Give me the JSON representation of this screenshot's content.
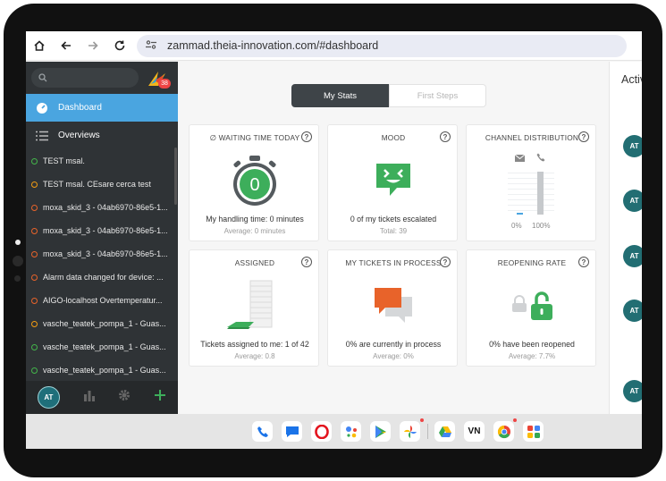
{
  "browser": {
    "url": "zammad.theia-innovation.com/#dashboard"
  },
  "sidebar": {
    "logo_badge": "38",
    "nav": [
      {
        "label": "Dashboard",
        "icon": "dashboard-icon"
      },
      {
        "label": "Overviews",
        "icon": "list-icon"
      }
    ],
    "tickets": [
      {
        "title": "TEST msal.",
        "status_color": "#43b54b"
      },
      {
        "title": "TEST msal. CEsare cerca test",
        "status_color": "#f39c12"
      },
      {
        "title": "moxa_skid_3 - 04ab6970-86e5-1...",
        "status_color": "#e8632a"
      },
      {
        "title": "moxa_skid_3 - 04ab6970-86e5-1...",
        "status_color": "#e8632a"
      },
      {
        "title": "moxa_skid_3 - 04ab6970-86e5-1...",
        "status_color": "#e8632a"
      },
      {
        "title": "Alarm data changed for device: ...",
        "status_color": "#e8632a"
      },
      {
        "title": "AIGO-localhost Overtemperatur...",
        "status_color": "#e8632a"
      },
      {
        "title": "vasche_teatek_pompa_1 - Guas...",
        "status_color": "#f39c12"
      },
      {
        "title": "vasche_teatek_pompa_1 - Guas...",
        "status_color": "#43b54b"
      },
      {
        "title": "vasche_teatek_pompa_1 - Guas...",
        "status_color": "#43b54b"
      }
    ],
    "footer": {
      "avatar_initials": "AT",
      "icons": [
        "stats-icon",
        "gear-icon",
        "plus-icon"
      ]
    }
  },
  "dashboard": {
    "tabs": [
      "My Stats",
      "First Steps"
    ],
    "cards": {
      "waiting": {
        "title": "∅ WAITING TIME TODAY",
        "value": "0",
        "line": "My handling time: 0 minutes",
        "sub": "Average: 0 minutes"
      },
      "mood": {
        "title": "MOOD",
        "line": "0 of my tickets escalated",
        "sub": "Total: 39"
      },
      "channel": {
        "title": "CHANNEL DISTRIBUTION",
        "labels": [
          "0%",
          "100%"
        ],
        "email_share": 0,
        "phone_share": 1
      },
      "assigned": {
        "title": "ASSIGNED",
        "line": "Tickets assigned to me: 1 of 42",
        "sub": "Average: 0.8"
      },
      "in_process": {
        "title": "MY TICKETS IN PROCESS",
        "line": "0% are currently in process",
        "sub": "Average: 0%"
      },
      "reopening": {
        "title": "REOPENING RATE",
        "line": "0% have been reopened",
        "sub": "Average: 7.7%"
      }
    }
  },
  "activity": {
    "title": "Activ",
    "avatars": [
      "AT",
      "AT",
      "AT",
      "AT",
      "AT"
    ]
  },
  "dock": {
    "apps": [
      "phone-icon",
      "messages-icon",
      "opera-icon",
      "assistant-icon",
      "play-store-icon",
      "photos-icon",
      "drive-icon",
      "vn-icon",
      "chrome-icon",
      "apps-icon"
    ],
    "vn_label": "VN"
  },
  "colors": {
    "accent": "#4aa5e0",
    "green": "#3dae5b",
    "orange": "#e8632a",
    "sidebar": "#2f3336"
  }
}
